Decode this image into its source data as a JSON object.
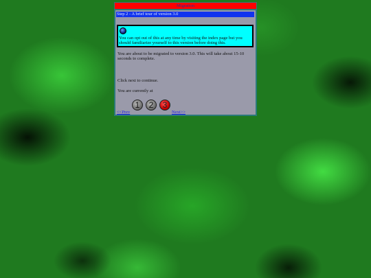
{
  "wizard": {
    "title": "Migration",
    "step_title": "Step 2 - A brief tour of version 3.0",
    "info_text": "You can opt out of this at any time by visiting the index page but you should familiarize yourself to this version before doing this.",
    "paragraph1": "You are about to be migrated to version 3.0. This will take about 15-10 seconds to complete.",
    "paragraph2": "Click next to continue.",
    "paragraph3": "You are currently at",
    "steps": [
      "1",
      "2",
      "3"
    ],
    "active_step": "3",
    "prev_label": "<<Prev",
    "next_label": "Next>>"
  },
  "colors": {
    "title_bar": "#ff0000",
    "step_bar": "#1133ee",
    "info_box": "#00ffff",
    "panel": "#9a9aaa",
    "frame": "#2a7a7a",
    "active_step": "#cc0000"
  },
  "icons": {
    "info": "info-orb-icon"
  }
}
